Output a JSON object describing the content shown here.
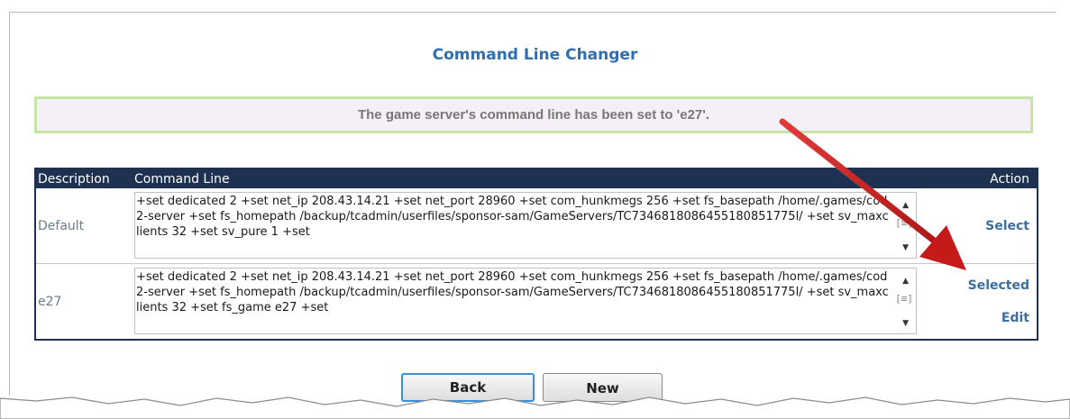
{
  "page": {
    "title": "Command Line Changer",
    "notice": "The game server's command line has been set to 'e27'."
  },
  "grid": {
    "headers": {
      "description": "Description",
      "command_line": "Command Line",
      "action": "Action"
    },
    "rows": [
      {
        "description": "Default",
        "command": "+set dedicated 2 +set net_ip 208.43.14.21 +set net_port 28960 +set com_hunkmegs 256 +set fs_basepath /home/.games/cod2-server +set fs_homepath /backup/tcadmin/userfiles/sponsor-sam/GameServers/TC7346818086455180851775l/ +set sv_maxclients 32 +set sv_pure 1 +set",
        "actions": [
          "Select"
        ]
      },
      {
        "description": "e27",
        "command": "+set dedicated 2 +set net_ip 208.43.14.21 +set net_port 28960 +set com_hunkmegs 256 +set fs_basepath /home/.games/cod2-server +set fs_homepath /backup/tcadmin/userfiles/sponsor-sam/GameServers/TC7346818086455180851775l/ +set sv_maxclients 32 +set fs_game e27 +set",
        "actions": [
          "Selected",
          "Edit"
        ]
      }
    ]
  },
  "buttons": {
    "back": "Back",
    "new": "New"
  },
  "colors": {
    "title": "#2d6fb0",
    "grid_header_bg": "#1f3150",
    "notice_border": "#c6e5a4",
    "notice_bg": "#f5f0f5",
    "action_link": "#3c6f9f",
    "annotation_arrow": "#cc1f1f"
  }
}
